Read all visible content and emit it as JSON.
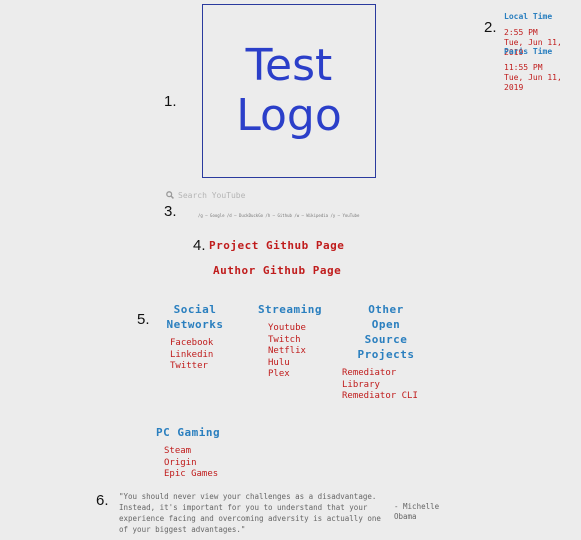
{
  "markers": [
    "1.",
    "2.",
    "3.",
    "4.",
    "5.",
    "6."
  ],
  "logo": {
    "text": "Test\nLogo"
  },
  "clocks": [
    {
      "title": "Local Time",
      "time": "2:55 PM",
      "date": "Tue, Jun 11, 2019"
    },
    {
      "title": "Paris Time",
      "time": "11:55 PM",
      "date": "Tue, Jun 11, 2019"
    }
  ],
  "search": {
    "icon": "search-icon",
    "placeholder": "Search YouTube",
    "shortcuts": "/g – Google /d – DuckDuckGo /h – Github /w – Wikipedia /y – YouTube"
  },
  "links": {
    "project": "Project Github Page",
    "author": "Author Github Page"
  },
  "categories": {
    "social": {
      "title": "Social\nNetworks",
      "items": [
        "Facebook",
        "Linkedin",
        "Twitter"
      ]
    },
    "streaming": {
      "title": "Streaming",
      "items": [
        "Youtube",
        "Twitch",
        "Netflix",
        "Hulu",
        "Plex"
      ]
    },
    "oss": {
      "title": "Other\nOpen\nSource\nProjects",
      "items": [
        "Remediator",
        "Library",
        "Remediator CLI"
      ]
    },
    "pcgaming": {
      "title": "PC Gaming",
      "items": [
        "Steam",
        "Origin",
        "Epic Games"
      ]
    }
  },
  "quote": {
    "text": "\"You should never view your challenges as a disadvantage. Instead, it's important for you to understand that your experience facing and overcoming adversity is actually one of your biggest advantages.\"",
    "author": "- Michelle Obama"
  },
  "colors": {
    "link": "#c01c1c",
    "heading": "#2a7fbf",
    "logo": "#2b3fc9"
  }
}
